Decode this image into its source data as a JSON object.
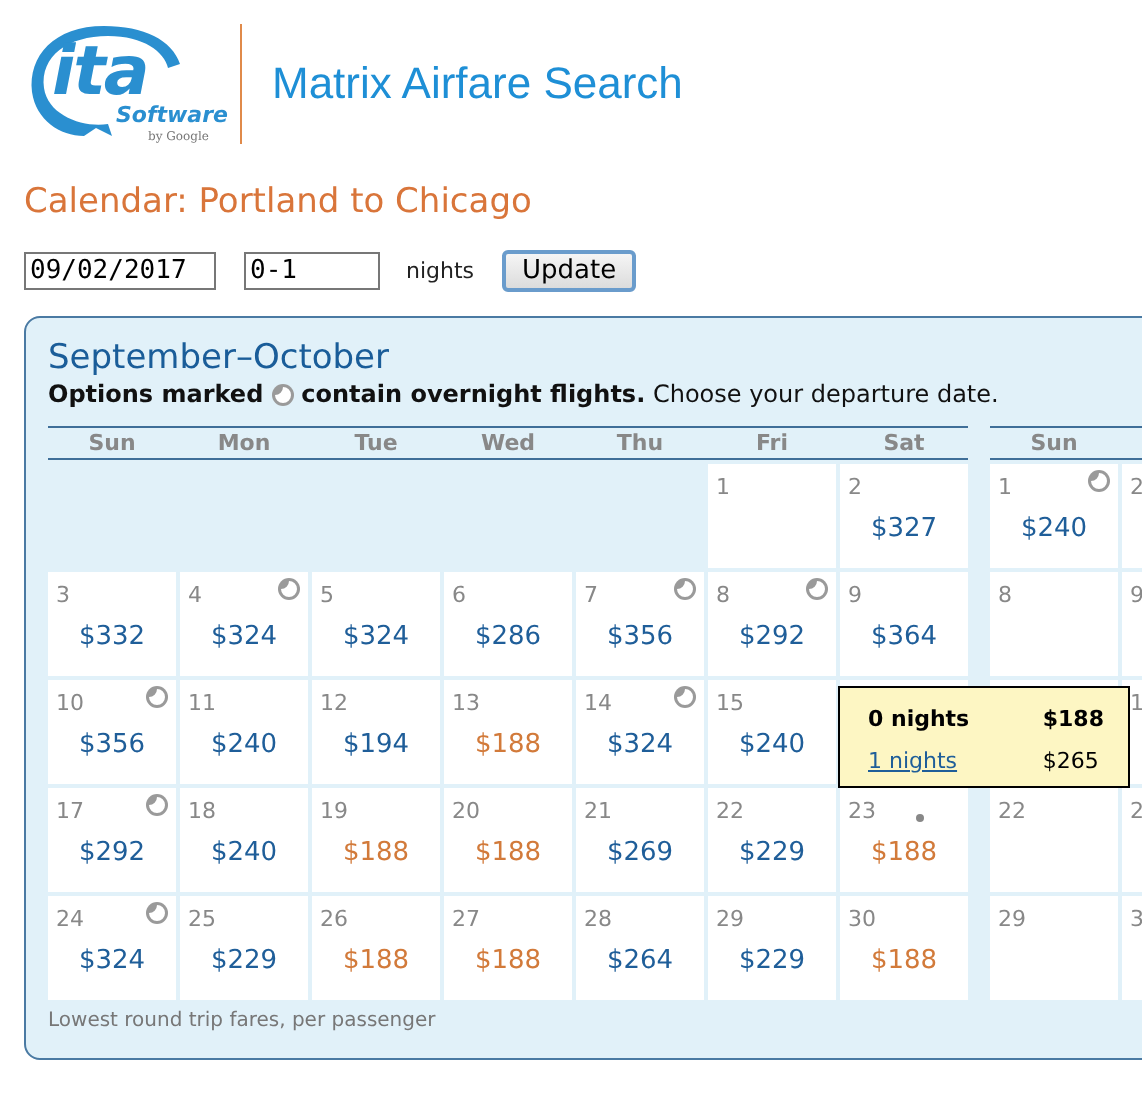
{
  "header": {
    "logo": {
      "wordmark": "ita",
      "subtitle": "Software",
      "byline": "by Google"
    },
    "title": "Matrix Airfare Search"
  },
  "page_title": "Calendar: Portland to Chicago",
  "form": {
    "date": "09/02/2017",
    "nights": "0-1",
    "nights_label": "nights",
    "button": "Update"
  },
  "calendar": {
    "title": "September–October",
    "legend_start": "Options marked",
    "legend_end": "**contain overnight flights.** Choose your departure date.",
    "footer": "Lowest round trip fares, per passenger",
    "months": [
      {
        "weekdays": [
          "Sun",
          "Mon",
          "Tue",
          "Wed",
          "Thu",
          "Fri",
          "Sat"
        ],
        "weeks": [
          [
            {
              "kind": "empty"
            },
            {
              "kind": "empty"
            },
            {
              "kind": "empty"
            },
            {
              "kind": "empty"
            },
            {
              "kind": "empty"
            },
            {
              "kind": "day",
              "day": "1"
            },
            {
              "kind": "day",
              "day": "2",
              "fare": "$327",
              "lowest": false,
              "overnight": false
            }
          ],
          [
            {
              "kind": "day",
              "day": "3",
              "fare": "$332",
              "lowest": false,
              "overnight": false
            },
            {
              "kind": "day",
              "day": "4",
              "fare": "$324",
              "lowest": false,
              "overnight": true
            },
            {
              "kind": "day",
              "day": "5",
              "fare": "$324",
              "lowest": false,
              "overnight": false
            },
            {
              "kind": "day",
              "day": "6",
              "fare": "$286",
              "lowest": false,
              "overnight": false
            },
            {
              "kind": "day",
              "day": "7",
              "fare": "$356",
              "lowest": false,
              "overnight": true
            },
            {
              "kind": "day",
              "day": "8",
              "fare": "$292",
              "lowest": false,
              "overnight": true
            },
            {
              "kind": "day",
              "day": "9",
              "fare": "$364",
              "lowest": false,
              "overnight": false
            }
          ],
          [
            {
              "kind": "day",
              "day": "10",
              "fare": "$356",
              "lowest": false,
              "overnight": true
            },
            {
              "kind": "day",
              "day": "11",
              "fare": "$240",
              "lowest": false,
              "overnight": false
            },
            {
              "kind": "day",
              "day": "12",
              "fare": "$194",
              "lowest": false,
              "overnight": false
            },
            {
              "kind": "day",
              "day": "13",
              "fare": "$188",
              "lowest": true,
              "overnight": false
            },
            {
              "kind": "day",
              "day": "14",
              "fare": "$324",
              "lowest": false,
              "overnight": true
            },
            {
              "kind": "day",
              "day": "15",
              "fare": "$240",
              "lowest": false,
              "overnight": false
            },
            {
              "kind": "covered"
            }
          ],
          [
            {
              "kind": "day",
              "day": "17",
              "fare": "$292",
              "lowest": false,
              "overnight": true
            },
            {
              "kind": "day",
              "day": "18",
              "fare": "$240",
              "lowest": false,
              "overnight": false
            },
            {
              "kind": "day",
              "day": "19",
              "fare": "$188",
              "lowest": true,
              "overnight": false
            },
            {
              "kind": "day",
              "day": "20",
              "fare": "$188",
              "lowest": true,
              "overnight": false
            },
            {
              "kind": "day",
              "day": "21",
              "fare": "$269",
              "lowest": false,
              "overnight": false
            },
            {
              "kind": "day",
              "day": "22",
              "fare": "$229",
              "lowest": false,
              "overnight": false
            },
            {
              "kind": "day",
              "day": "23",
              "fare": "$188",
              "lowest": true,
              "overnight": false,
              "pointer": true
            }
          ],
          [
            {
              "kind": "day",
              "day": "24",
              "fare": "$324",
              "lowest": false,
              "overnight": true
            },
            {
              "kind": "day",
              "day": "25",
              "fare": "$229",
              "lowest": false,
              "overnight": false
            },
            {
              "kind": "day",
              "day": "26",
              "fare": "$188",
              "lowest": true,
              "overnight": false
            },
            {
              "kind": "day",
              "day": "27",
              "fare": "$188",
              "lowest": true,
              "overnight": false
            },
            {
              "kind": "day",
              "day": "28",
              "fare": "$264",
              "lowest": false,
              "overnight": false
            },
            {
              "kind": "day",
              "day": "29",
              "fare": "$229",
              "lowest": false,
              "overnight": false
            },
            {
              "kind": "day",
              "day": "30",
              "fare": "$188",
              "lowest": true,
              "overnight": false
            }
          ]
        ]
      },
      {
        "weekdays": [
          "Sun"
        ],
        "weeks": [
          [
            {
              "kind": "day",
              "day": "1",
              "fare": "$240",
              "lowest": false,
              "overnight": true
            },
            {
              "kind": "day",
              "day": "2"
            }
          ],
          [
            {
              "kind": "day",
              "day": "8"
            },
            {
              "kind": "day",
              "day": "9"
            }
          ],
          [
            {
              "kind": "covered"
            },
            {
              "kind": "day",
              "day": "1"
            }
          ],
          [
            {
              "kind": "day",
              "day": "22"
            },
            {
              "kind": "day",
              "day": "2"
            }
          ],
          [
            {
              "kind": "day",
              "day": "29"
            },
            {
              "kind": "day",
              "day": "3"
            }
          ]
        ]
      }
    ],
    "popup": {
      "rows": [
        {
          "label": "0 nights",
          "price": "$188",
          "selected": true
        },
        {
          "label": "1 nights",
          "price": "$265",
          "selected": false
        }
      ]
    }
  }
}
